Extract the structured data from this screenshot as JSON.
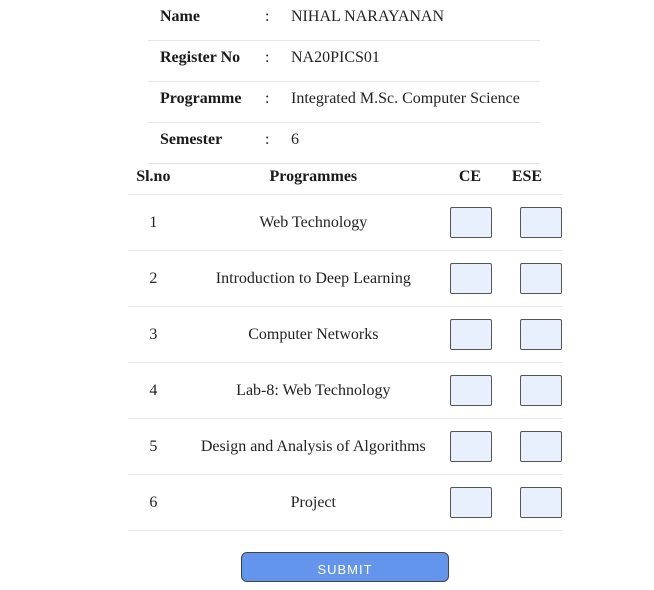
{
  "student": {
    "rows": [
      {
        "label": "Name",
        "value": "NIHAL NARAYANAN"
      },
      {
        "label": "Register No",
        "value": "NA20PICS01"
      },
      {
        "label": "Programme",
        "value": "Integrated M.Sc. Computer Science"
      },
      {
        "label": "Semester",
        "value": "6"
      }
    ],
    "separator": ":"
  },
  "table": {
    "headers": {
      "slno": "Sl.no",
      "programmes": "Programmes",
      "ce": "CE",
      "ese": "ESE"
    },
    "rows": [
      {
        "slno": "1",
        "programme": "Web Technology",
        "ce": "",
        "ese": ""
      },
      {
        "slno": "2",
        "programme": "Introduction to Deep Learning",
        "ce": "",
        "ese": ""
      },
      {
        "slno": "3",
        "programme": "Computer Networks",
        "ce": "",
        "ese": ""
      },
      {
        "slno": "4",
        "programme": "Lab-8: Web Technology",
        "ce": "",
        "ese": ""
      },
      {
        "slno": "5",
        "programme": "Design and Analysis of Algorithms",
        "ce": "",
        "ese": ""
      },
      {
        "slno": "6",
        "programme": "Project",
        "ce": "",
        "ese": ""
      }
    ]
  },
  "submit": {
    "label": "SUBMIT"
  },
  "colors": {
    "submit_bg": "#6495ed",
    "input_bg": "#e8f0fe"
  }
}
